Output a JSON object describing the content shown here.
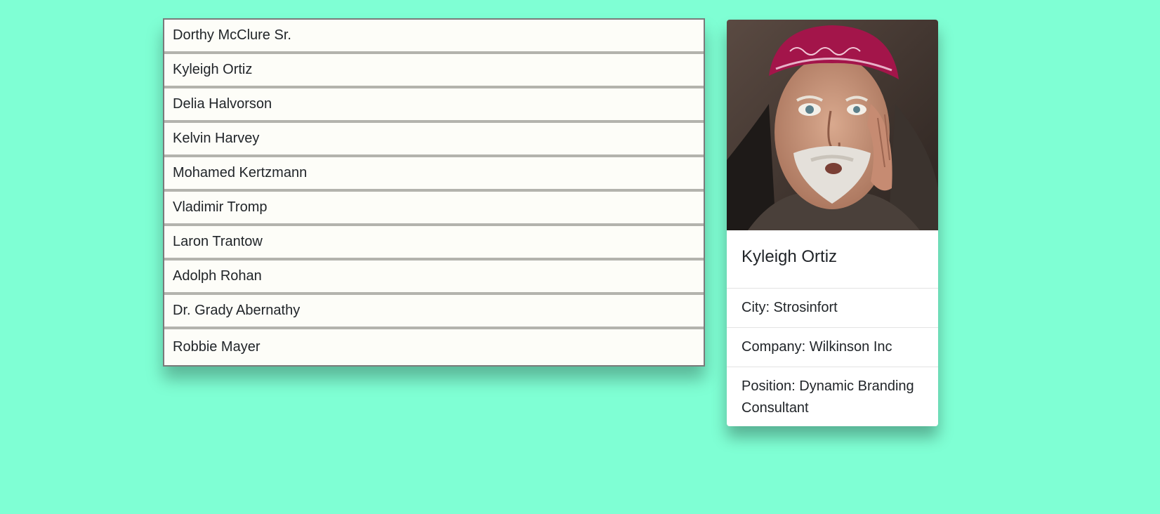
{
  "people": [
    "Dorthy McClure Sr.",
    "Kyleigh Ortiz",
    "Delia Halvorson",
    "Kelvin Harvey",
    "Mohamed Kertzmann",
    "Vladimir Tromp",
    "Laron Trantow",
    "Adolph Rohan",
    "Dr. Grady Abernathy",
    "Robbie Mayer"
  ],
  "card": {
    "name": "Kyleigh Ortiz",
    "city": "City: Strosinfort",
    "company": "Company: Wilkinson Inc",
    "position": "Position: Dynamic Branding Consultant"
  },
  "colors": {
    "background": "#7fffd4",
    "list_item_bg": "#fdfdf8",
    "bandana": "#a3154a"
  }
}
